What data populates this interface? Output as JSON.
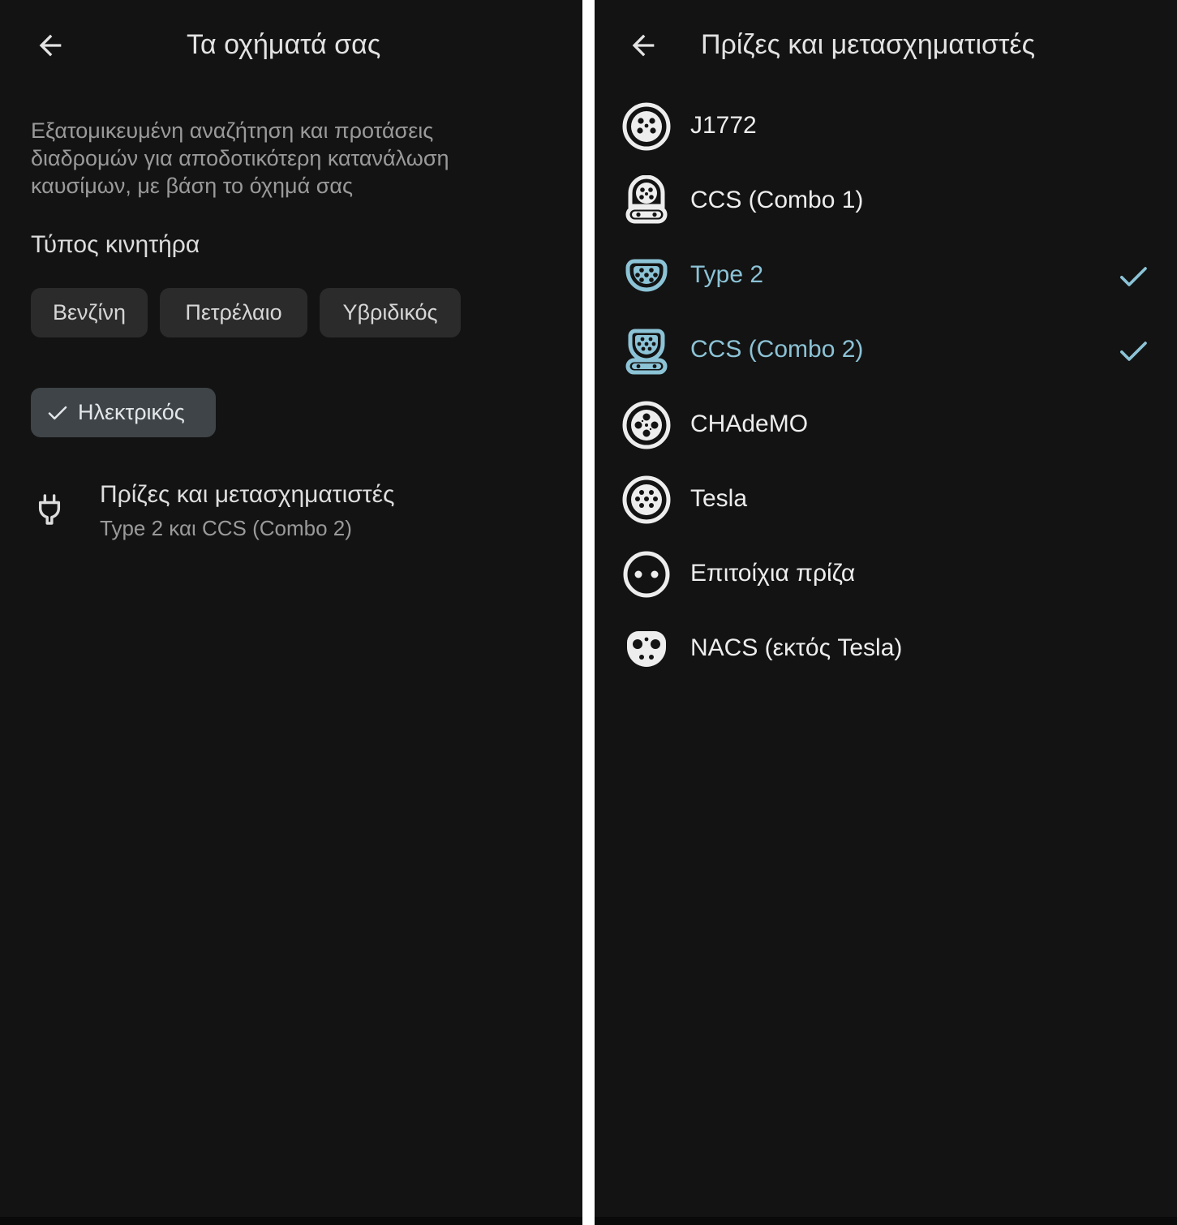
{
  "vehicle_screen": {
    "title": "Τα οχήματά σας",
    "description": "Εξατομικευμένη αναζήτηση και προτάσεις διαδρομών για αποδοτικότερη κατανάλωση καυσίμων, με βάση το όχημά σας",
    "engine_type_label": "Τύπος κινητήρα",
    "engine_types": [
      {
        "label": "Βενζίνη",
        "selected": false
      },
      {
        "label": "Πετρέλαιο",
        "selected": false
      },
      {
        "label": "Υβριδικός",
        "selected": false
      },
      {
        "label": "Ηλεκτρικός",
        "selected": true
      }
    ],
    "plugs_row": {
      "title": "Πρίζες και μετασχηματιστές",
      "subtitle": "Type 2 και CCS (Combo 2)",
      "icon": "plug-icon"
    }
  },
  "plugs_screen": {
    "title": "Πρίζες και μετασχηματιστές",
    "connectors": [
      {
        "label": "J1772",
        "icon": "j1772-icon",
        "selected": false
      },
      {
        "label": "CCS (Combo 1)",
        "icon": "ccs-combo1-icon",
        "selected": false
      },
      {
        "label": "Type 2",
        "icon": "type2-icon",
        "selected": true
      },
      {
        "label": "CCS (Combo 2)",
        "icon": "ccs-combo2-icon",
        "selected": true
      },
      {
        "label": "CHAdeMO",
        "icon": "chademo-icon",
        "selected": false
      },
      {
        "label": "Tesla",
        "icon": "tesla-icon",
        "selected": false
      },
      {
        "label": "Επιτοίχια πρίζα",
        "icon": "wall-outlet-icon",
        "selected": false
      },
      {
        "label": "NACS (εκτός Tesla)",
        "icon": "nacs-icon",
        "selected": false
      }
    ]
  },
  "colors": {
    "background": "#131313",
    "text_primary": "#ededed",
    "text_secondary": "#9a9a9a",
    "chip_bg": "#2b2b2b",
    "chip_selected_bg": "#3e4447",
    "accent": "#8cc3d6"
  }
}
